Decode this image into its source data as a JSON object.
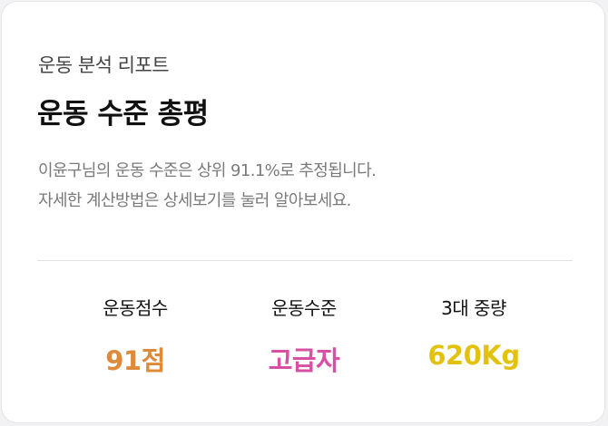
{
  "report": {
    "subtitle": "운동 분석 리포트",
    "title": "운동 수준 총평",
    "description_line1": "이윤구님의 운동 수준은 상위 91.1%로 추정됩니다.",
    "description_line2": "자세한 계산방법은 상세보기를 눌러 알아보세요."
  },
  "stats": [
    {
      "label": "운동점수",
      "value": "91점",
      "color": "#dd8a3a"
    },
    {
      "label": "운동수준",
      "value": "고급자",
      "color": "#d94fa3"
    },
    {
      "label": "3대 중량",
      "value": "620Kg",
      "color": "#e2c20f"
    }
  ]
}
